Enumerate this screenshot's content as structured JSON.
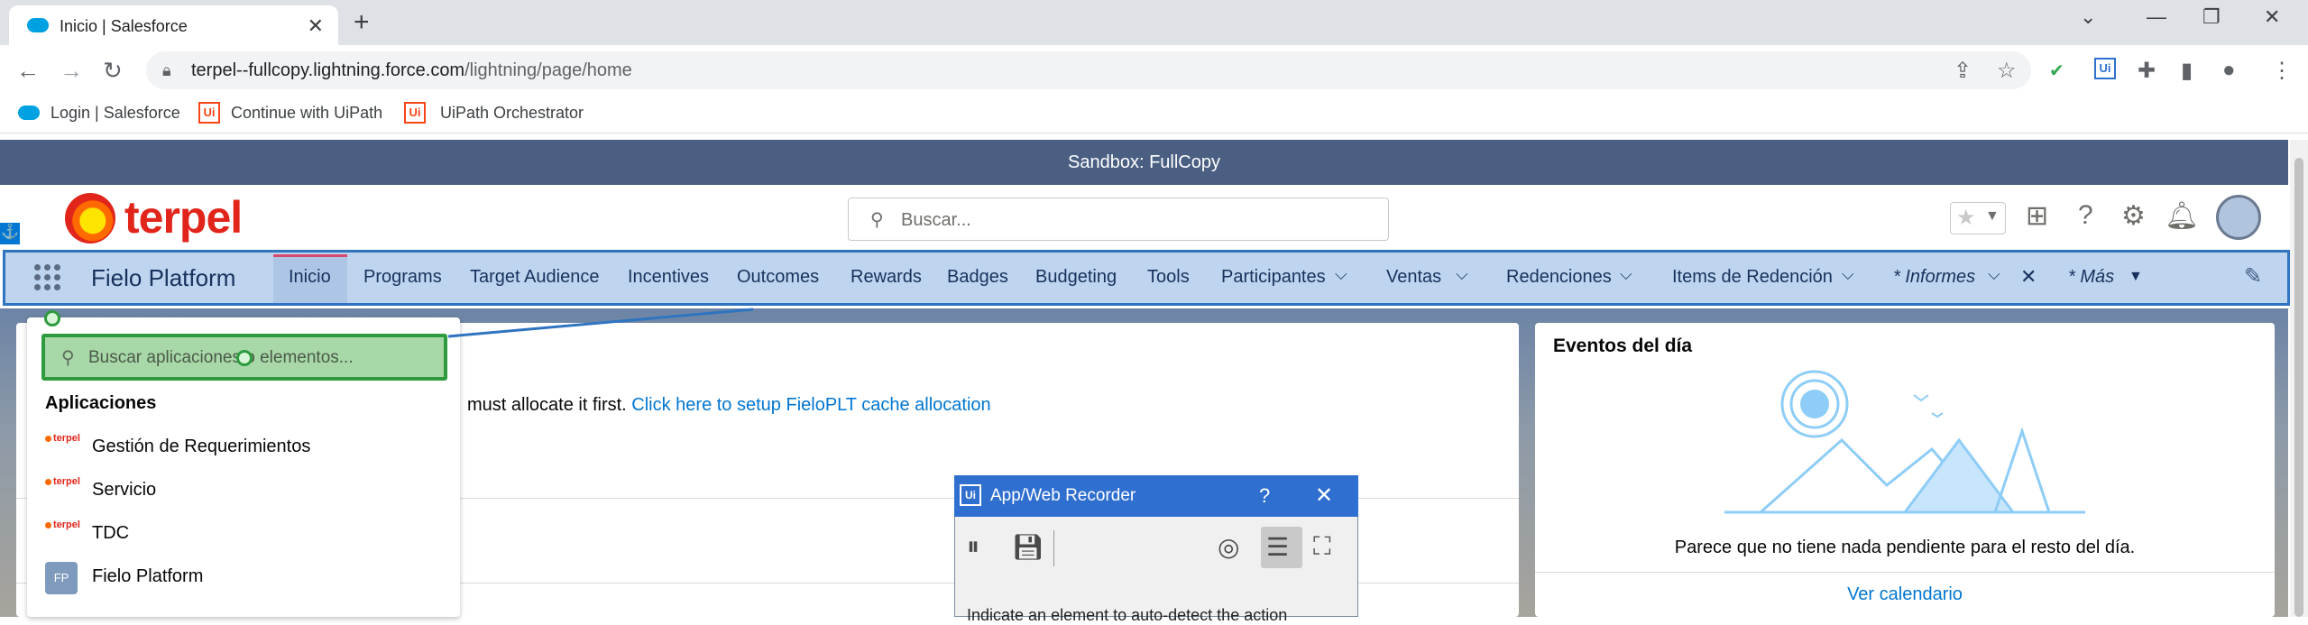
{
  "browser": {
    "tab_title": "Inicio | Salesforce",
    "url_domain": "terpel--fullcopy.lightning.force.com",
    "url_path": "/lightning/page/home",
    "bookmarks": [
      "Login | Salesforce",
      "Continue with UiPath",
      "UiPath Orchestrator"
    ],
    "icons": [
      "salesforce-cloud-icon",
      "close-icon",
      "new-tab-icon",
      "chevron-down-icon",
      "minimize-icon",
      "restore-icon",
      "back-icon",
      "forward-icon",
      "reload-icon",
      "lock-icon",
      "share-icon",
      "star-icon",
      "extension-icon",
      "uipath-extension-icon",
      "puzzle-icon",
      "sidepanel-icon",
      "profile-icon",
      "menu-icon"
    ]
  },
  "salesforce": {
    "sandbox_banner": "Sandbox: FullCopy",
    "logo_text": "terpel",
    "search_placeholder": "Buscar...",
    "app_name": "Fielo Platform",
    "nav_items": [
      "Inicio",
      "Programs",
      "Target Audience",
      "Incentives",
      "Outcomes",
      "Rewards",
      "Badges",
      "Budgeting",
      "Tools",
      "Participantes",
      "Ventas",
      "Redenciones",
      "Items de Redención",
      "* Informes",
      "* Más"
    ],
    "active_nav": "Inicio",
    "cache_message": "must allocate it first.",
    "cache_link": "Click here to setup FieloPLT cache allocation",
    "events": {
      "title": "Eventos del día",
      "empty_message": "Parece que no tiene nada pendiente para el resto del día.",
      "link": "Ver calendario"
    },
    "colors": {
      "sandbox_bg": "#4a5f82",
      "nav_bg": "#bfd4ef",
      "nav_highlight_border": "#2f74c0",
      "active_tab_accent": "#d64a6d",
      "link": "#0176d3",
      "terpel_red": "#e1251b"
    }
  },
  "launcher": {
    "search_placeholder": "Buscar aplicaciones o elementos...",
    "section_title": "Aplicaciones",
    "apps": [
      {
        "name": "Gestión de Requerimientos",
        "icon": "terpel"
      },
      {
        "name": "Servicio",
        "icon": "terpel"
      },
      {
        "name": "TDC",
        "icon": "terpel"
      },
      {
        "name": "Fielo Platform",
        "icon": "FP"
      }
    ],
    "mini_logo_text": "terpel"
  },
  "recorder": {
    "title": "App/Web Recorder",
    "help": "?",
    "logo": "Ui",
    "hint": "Indicate an element to auto-detect the action",
    "highlight_color": "#2e9b3e"
  }
}
